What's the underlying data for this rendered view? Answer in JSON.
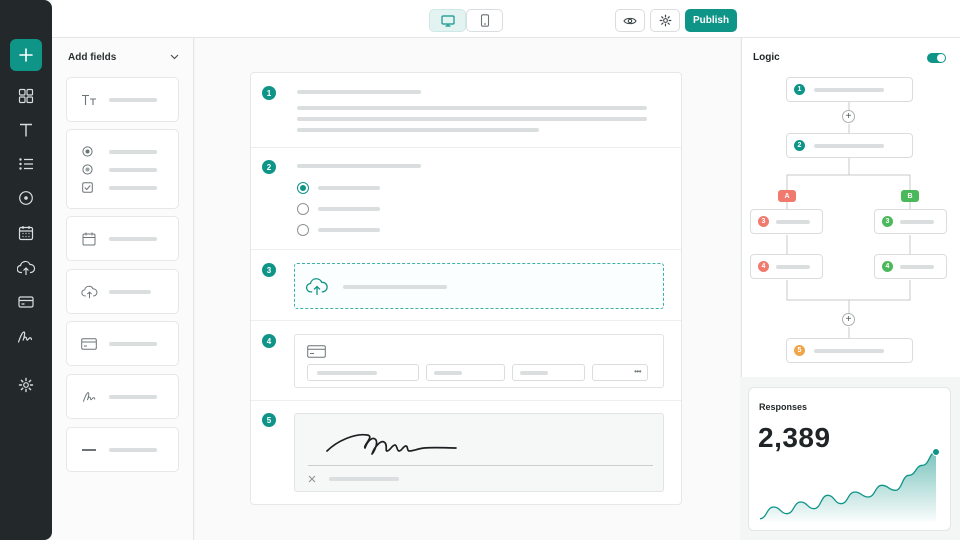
{
  "topbar": {
    "device_modes": [
      "desktop-icon",
      "mobile-icon"
    ],
    "preview_icon": "eye-icon",
    "settings_icon": "gear-icon",
    "publish_label": "Publish"
  },
  "rail": {
    "icons": [
      "plus-icon",
      "grid-icon",
      "text-icon",
      "list-icon",
      "radio-icon",
      "calendar-icon",
      "upload-icon",
      "card-icon",
      "signature-icon",
      "settings-icon"
    ]
  },
  "fields_panel": {
    "title": "Add fields",
    "items": [
      "text-field",
      "choice-field",
      "date-field",
      "upload-field",
      "payment-field",
      "signature-field",
      "divider-field"
    ]
  },
  "form": {
    "sections": [
      {
        "number": "1",
        "type": "text"
      },
      {
        "number": "2",
        "type": "multiple-choice"
      },
      {
        "number": "3",
        "type": "file-upload"
      },
      {
        "number": "4",
        "type": "payment"
      },
      {
        "number": "5",
        "type": "signature"
      }
    ],
    "more_glyph": "•••"
  },
  "logic": {
    "title": "Logic",
    "enabled": true,
    "branch_a": "A",
    "branch_b": "B",
    "nodes": {
      "n1": "1",
      "n2": "2",
      "a3": "3",
      "a4": "4",
      "b3": "3",
      "b4": "4",
      "n5": "5"
    },
    "colors": {
      "teal": "#0f9488",
      "branch_a": "#ef7a6d",
      "branch_b": "#4cb85c",
      "final": "#f1a54a"
    }
  },
  "responses": {
    "label": "Responses",
    "value": "2,389"
  },
  "chart_data": {
    "type": "area",
    "series": [
      {
        "values": [
          2,
          9,
          5,
          12,
          8,
          16,
          11,
          18,
          15,
          22,
          19,
          28,
          34,
          42
        ]
      }
    ]
  }
}
